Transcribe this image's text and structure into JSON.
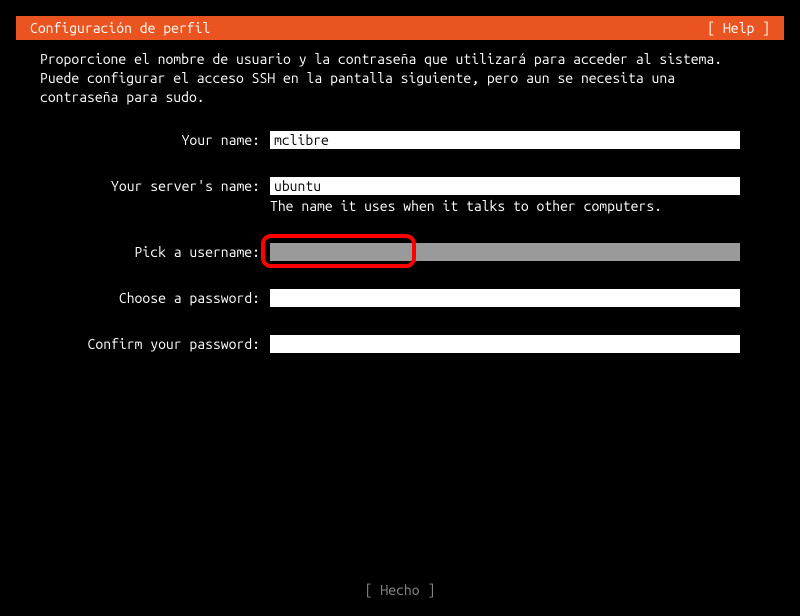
{
  "header": {
    "title": "Configuración de perfil",
    "help": "[ Help ]"
  },
  "intro": "Proporcione el nombre de usuario y la contraseña que utilizará para acceder al sistema. Puede configurar el acceso SSH en la pantalla siguiente, pero aun se necesita una contraseña para sudo.",
  "form": {
    "name": {
      "label": "Your name:",
      "value": "mclibre"
    },
    "server": {
      "label": "Your server's name:",
      "value": "ubuntu",
      "hint": "The name it uses when it talks to other computers."
    },
    "username": {
      "label": "Pick a username:",
      "value": ""
    },
    "password": {
      "label": "Choose a password:",
      "value": ""
    },
    "confirm": {
      "label": "Confirm your password:",
      "value": ""
    }
  },
  "footer": {
    "done": "[ Hecho     ]"
  }
}
